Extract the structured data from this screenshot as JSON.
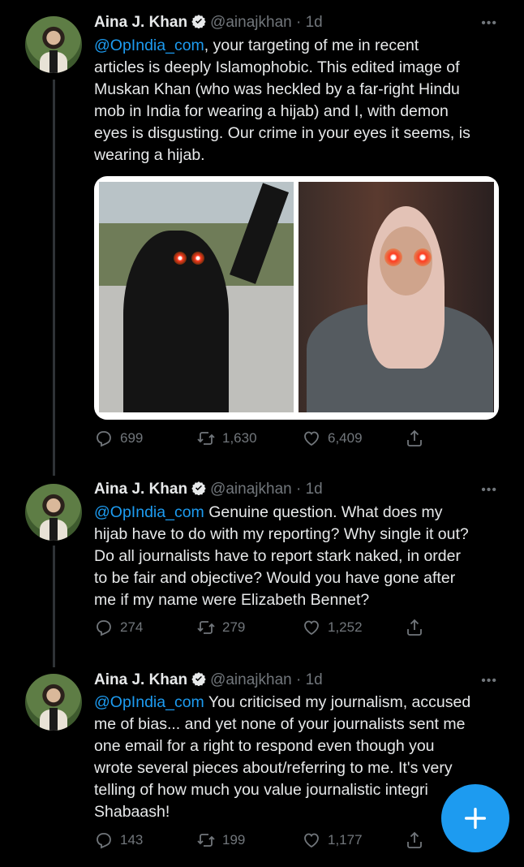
{
  "tweets": [
    {
      "name": "Aina J. Khan",
      "handle": "@ainajkhan · 1d",
      "mention": "@OpIndia_com",
      "text": ", your targeting of me in recent\narticles is deeply Islamophobic. This edited image of\nMuskan Khan (who was heckled by a far-right Hindu\nmob in India for wearing a hijab) and I, with demon\neyes is disgusting. Our crime in your eyes it seems, is\nwearing a hijab.",
      "replies": "699",
      "retweets": "1,630",
      "likes": "6,409"
    },
    {
      "name": "Aina J. Khan",
      "handle": "@ainajkhan · 1d",
      "mention": "@OpIndia_com",
      "text": " Genuine question. What does my\nhijab have to do with my reporting? Why single it out?\nDo all journalists have to report stark naked, in order\nto be fair and objective? Would you have gone after\nme if my name were Elizabeth Bennet?",
      "replies": "274",
      "retweets": "279",
      "likes": "1,252"
    },
    {
      "name": "Aina J. Khan",
      "handle": "@ainajkhan · 1d",
      "mention": "@OpIndia_com",
      "text": " You criticised my journalism, accused\nme of bias... and yet none of your journalists sent me\none email for a right to respond even though you\nwrote several pieces about/referring to me. It's very\ntelling of how much you value journalistic integri\nShabaash!",
      "replies": "143",
      "retweets": "199",
      "likes": "1,177"
    }
  ],
  "more_label": "•••",
  "icons": [
    "verified-icon",
    "reply-icon",
    "retweet-icon",
    "like-icon",
    "share-icon",
    "compose-plus-icon"
  ],
  "colors": {
    "accent": "#1d9bf0",
    "muted": "#71767b",
    "text": "#e7e9ea",
    "background": "#000000"
  }
}
